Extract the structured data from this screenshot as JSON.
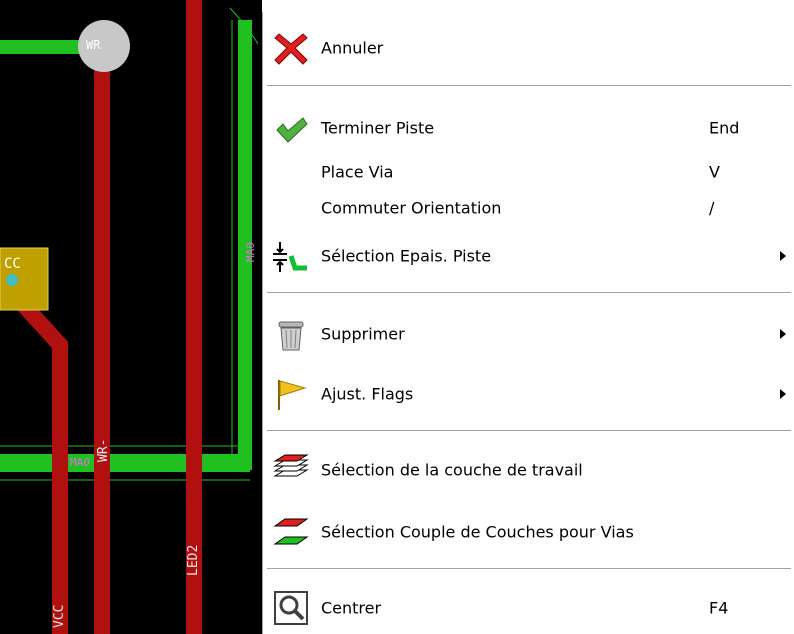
{
  "pcb": {
    "labels": {
      "wr_pad": "WR",
      "wr_track": "WR-",
      "md0_track": "MA0",
      "md0_side": "MA0",
      "cc_pad": "CC",
      "led2": "LED2",
      "vcc": "VCC"
    }
  },
  "menu": {
    "items": [
      {
        "label": "Annuler",
        "icon": "red-x-cancel-icon"
      },
      {
        "label": "Terminer Piste",
        "shortcut": "End",
        "icon": "green-check-icon"
      },
      {
        "label": "Place Via",
        "shortcut": "V"
      },
      {
        "label": "Commuter Orientation",
        "shortcut": "/"
      },
      {
        "label": "Sélection Epais. Piste",
        "icon": "track-width-icon",
        "submenu": true
      },
      {
        "label": "Supprimer",
        "icon": "trash-can-icon",
        "submenu": true
      },
      {
        "label": "Ajust. Flags",
        "icon": "yellow-flag-icon",
        "submenu": true
      },
      {
        "label": "Sélection de la couche de travail",
        "icon": "layer-stack-icon"
      },
      {
        "label": "Sélection Couple de Couches pour Vias",
        "icon": "layer-pair-icon"
      },
      {
        "label": "Centrer",
        "shortcut": "F4",
        "icon": "zoom-center-icon"
      }
    ]
  },
  "colors": {
    "track_red": "#b01010",
    "track_green": "#20c020",
    "pad_gold": "#c0a000",
    "menu_bg": "#ffffff",
    "separator": "#a0a0a0"
  }
}
